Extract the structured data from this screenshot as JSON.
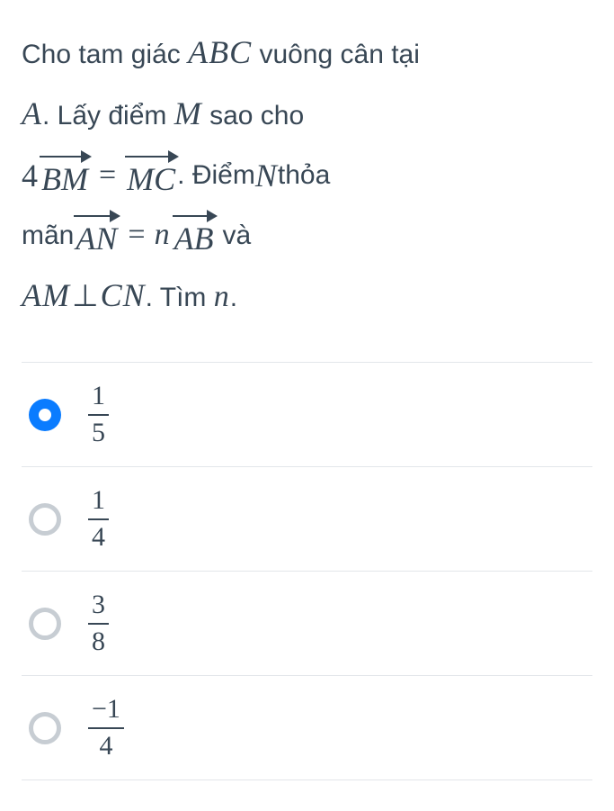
{
  "question": {
    "parts": {
      "p1a": "Cho tam giác ",
      "p1b": "ABC",
      "p1c": " vuông cân tại",
      "p2a": "A",
      "p2b": ". Lấy điểm ",
      "p2c": "M",
      "p2d": " sao cho",
      "vec1_coef": "4",
      "vec1": "BM",
      "vec2": "MC",
      "p3a": ". Điểm ",
      "p3b": "N",
      "p3c": " thỏa",
      "p4a": "mãn ",
      "vec3": "AN",
      "vec4_coef": "n",
      "vec4": "AB",
      "p4b": " và",
      "p5a": "AM",
      "perp": "⊥",
      "p5b": "CN",
      "p5c": ". Tìm ",
      "p5d": "n",
      "p5e": "."
    }
  },
  "options": [
    {
      "selected": true,
      "num": "1",
      "den": "5"
    },
    {
      "selected": false,
      "num": "1",
      "den": "4"
    },
    {
      "selected": false,
      "num": "3",
      "den": "8"
    },
    {
      "selected": false,
      "num": "−1",
      "den": "4"
    }
  ]
}
